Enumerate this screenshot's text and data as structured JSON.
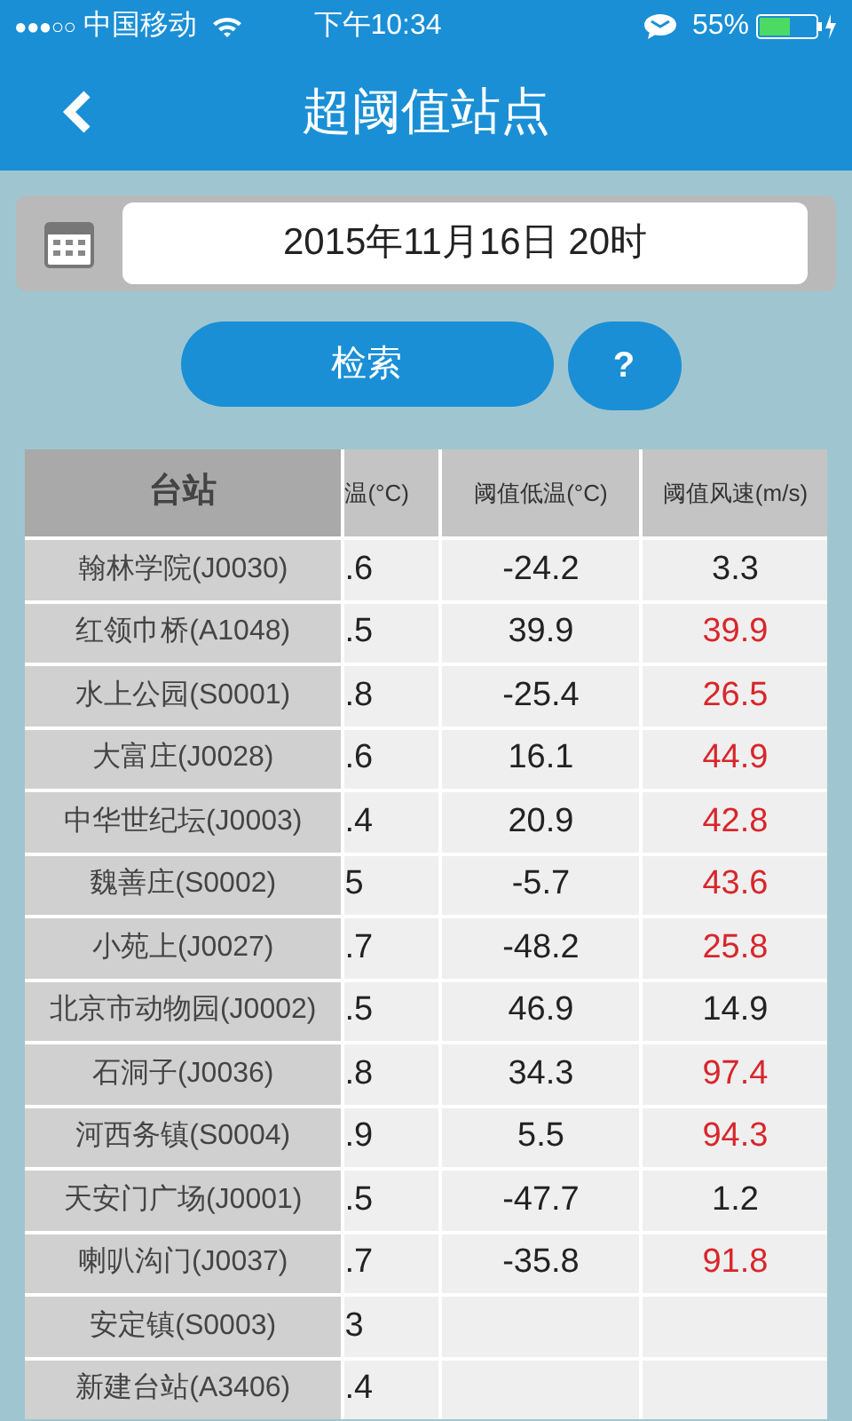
{
  "status_bar": {
    "signal": "●●●○○",
    "carrier": "中国移动",
    "time": "下午10:34",
    "battery": "55%"
  },
  "header": {
    "title": "超阈值站点"
  },
  "date_field": {
    "value": "2015年11月16日 20时"
  },
  "buttons": [
    {
      "label": "检索",
      "kind": "pill"
    },
    {
      "label": "?",
      "kind": "circle"
    }
  ],
  "table": {
    "frozen_column": "台站",
    "columns": [
      "温(°C)",
      "阈值低温(°C)",
      "阈值风速(m/s)"
    ],
    "rows": [
      {
        "station": "翰林学院(J0030)",
        "cells": [
          ".6",
          "-24.2",
          "3.3"
        ],
        "alert": false
      },
      {
        "station": "红领巾桥(A1048)",
        "cells": [
          ".5",
          "39.9",
          "39.9"
        ],
        "alert": true
      },
      {
        "station": "水上公园(S0001)",
        "cells": [
          ".8",
          "-25.4",
          "26.5"
        ],
        "alert": true
      },
      {
        "station": "大富庄(J0028)",
        "cells": [
          ".6",
          "16.1",
          "44.9"
        ],
        "alert": true
      },
      {
        "station": "中华世纪坛(J0003)",
        "cells": [
          ".4",
          "20.9",
          "42.8"
        ],
        "alert": true
      },
      {
        "station": "魏善庄(S0002)",
        "cells": [
          "5",
          "-5.7",
          "43.6"
        ],
        "alert": true
      },
      {
        "station": "小苑上(J0027)",
        "cells": [
          ".7",
          "-48.2",
          "25.8"
        ],
        "alert": true
      },
      {
        "station": "北京市动物园(J0002)",
        "cells": [
          ".5",
          "46.9",
          "14.9"
        ],
        "alert": false
      },
      {
        "station": "石洞子(J0036)",
        "cells": [
          ".8",
          "34.3",
          "97.4"
        ],
        "alert": true
      },
      {
        "station": "河西务镇(S0004)",
        "cells": [
          ".9",
          "5.5",
          "94.3"
        ],
        "alert": true
      },
      {
        "station": "天安门广场(J0001)",
        "cells": [
          ".5",
          "-47.7",
          "1.2"
        ],
        "alert": false
      },
      {
        "station": "喇叭沟门(J0037)",
        "cells": [
          ".7",
          "-35.8",
          "91.8"
        ],
        "alert": true
      },
      {
        "station": "安定镇(S0003)",
        "cells": [
          "3"
        ]
      },
      {
        "station": "新建台站(A3406)",
        "cells": [
          ".4"
        ]
      }
    ]
  }
}
